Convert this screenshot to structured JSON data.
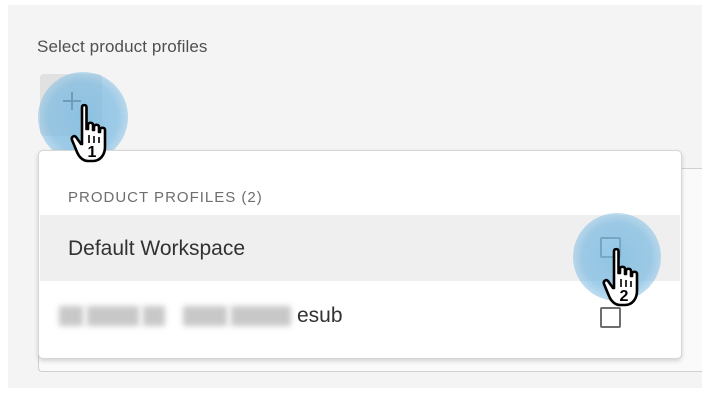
{
  "form": {
    "section_label": "Select product profiles"
  },
  "add_button": {
    "icon": "plus-icon"
  },
  "dropdown": {
    "header": "PRODUCT PROFILES (2)",
    "items": [
      {
        "label": "Default Workspace",
        "checked": false
      },
      {
        "label": "esub",
        "label_partially_redacted": true,
        "checked": false
      }
    ]
  },
  "annotations": {
    "step_1": "1",
    "step_2": "2",
    "cursor_icon": "hand-pointer-icon",
    "highlight_color": "#78b9e1"
  },
  "colors": {
    "panel_background": "#f4f4f4",
    "text_primary": "#323232",
    "text_secondary": "#6e6e6e",
    "row_hover": "#efefef"
  }
}
